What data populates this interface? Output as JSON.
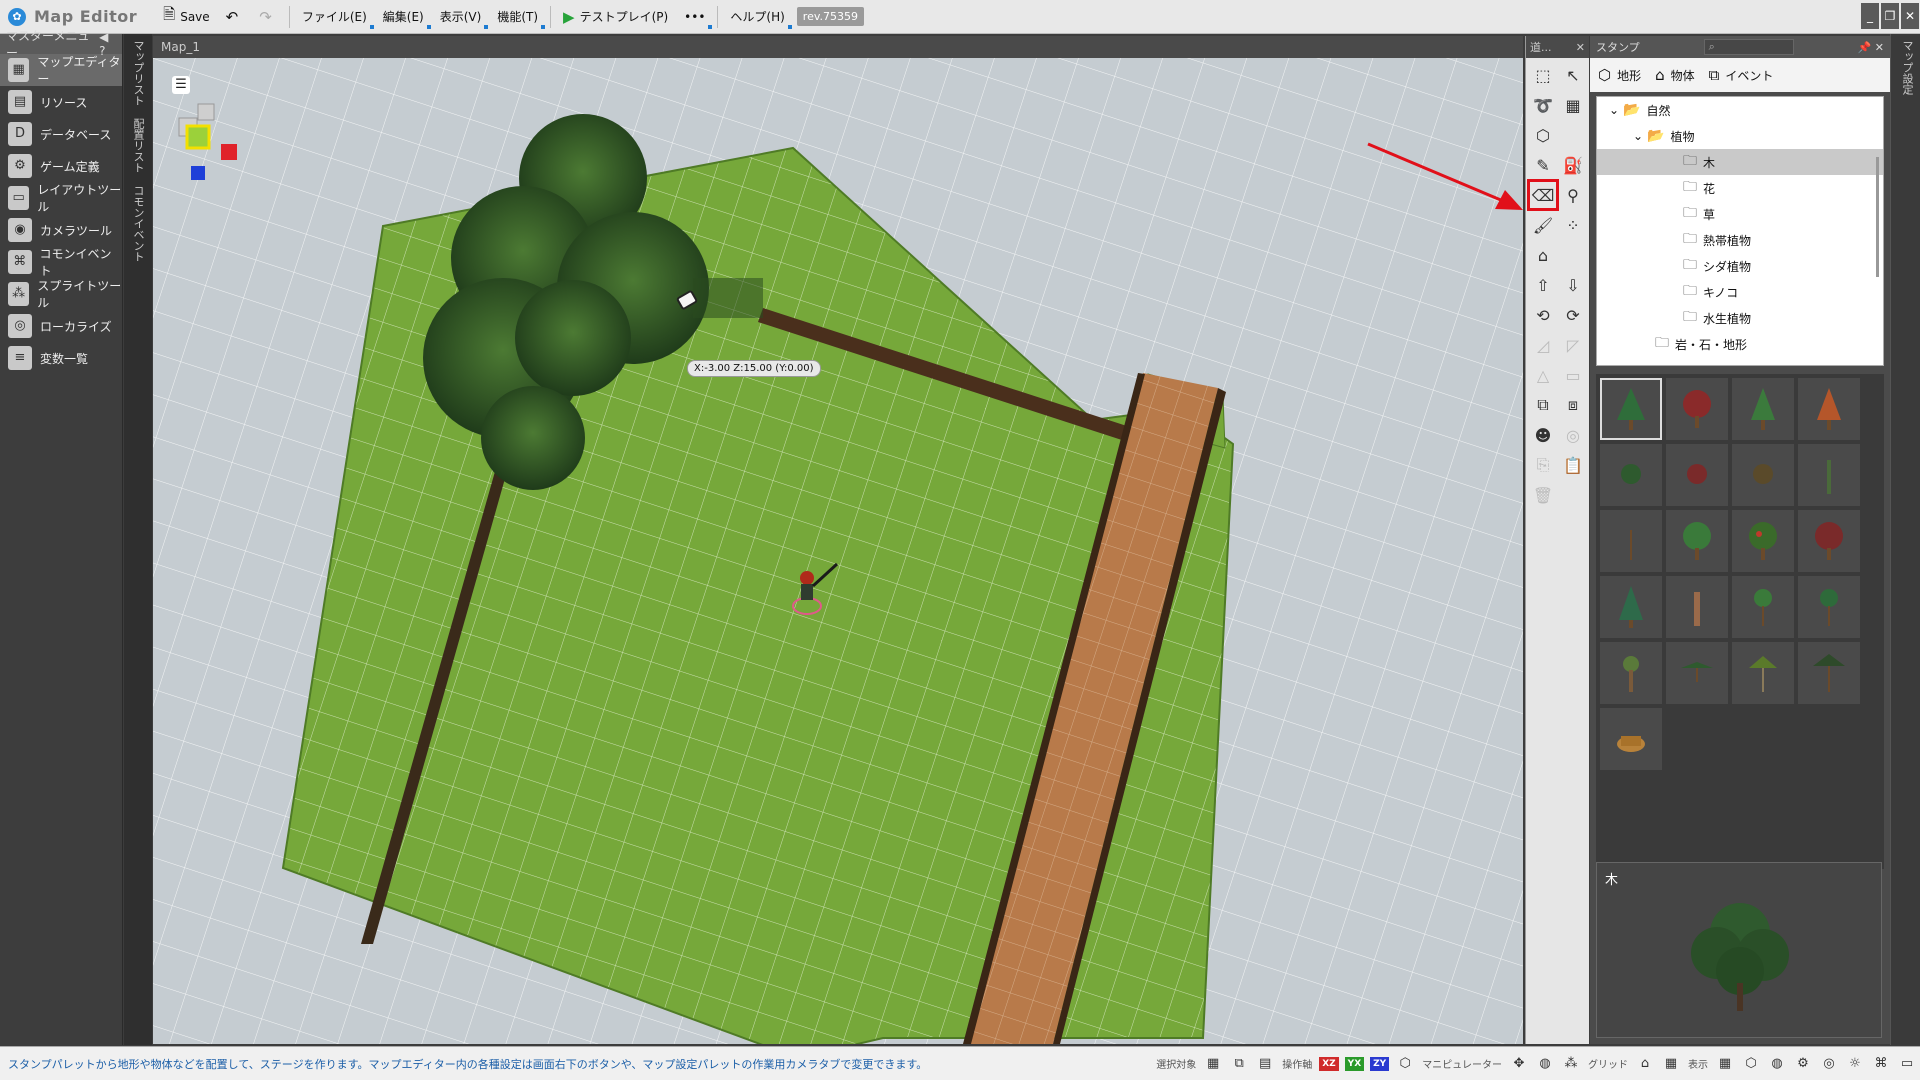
{
  "app": {
    "title": "Map Editor",
    "rev": "rev.75359"
  },
  "toolbar": {
    "save": "Save",
    "file": "ファイル(E)",
    "edit": "編集(E)",
    "view": "表示(V)",
    "func": "機能(T)",
    "testplay": "テストプレイ(P)",
    "more": "•••",
    "help": "ヘルプ(H)"
  },
  "master_menu": {
    "title": "マスターメニュー",
    "items": [
      {
        "label": "マップエディター",
        "icon": "map-icon"
      },
      {
        "label": "リソース",
        "icon": "resource-icon"
      },
      {
        "label": "データベース",
        "icon": "database-icon"
      },
      {
        "label": "ゲーム定義",
        "icon": "game-icon"
      },
      {
        "label": "レイアウトツール",
        "icon": "layout-icon"
      },
      {
        "label": "カメラツール",
        "icon": "camera-icon"
      },
      {
        "label": "コモンイベント",
        "icon": "event-icon"
      },
      {
        "label": "スプライトツール",
        "icon": "sprite-icon"
      },
      {
        "label": "ローカライズ",
        "icon": "globe-icon"
      },
      {
        "label": "変数一覧",
        "icon": "variable-icon"
      }
    ]
  },
  "vertical_tabs": {
    "map_list": "マップリスト",
    "placement_list": "配置リスト",
    "common_event": "コモンイベント"
  },
  "viewport": {
    "title": "Map_1",
    "coord": "X:-3.00 Z:15.00 (Y:0.00)"
  },
  "tools_panel": {
    "title": "道..."
  },
  "stamp_panel": {
    "title": "スタンプ",
    "tabs": [
      "地形",
      "物体",
      "イベント"
    ],
    "tree": [
      {
        "label": "自然",
        "depth": 0
      },
      {
        "label": "植物",
        "depth": 1
      },
      {
        "label": "木",
        "depth": 2,
        "selected": true
      },
      {
        "label": "花",
        "depth": 2
      },
      {
        "label": "草",
        "depth": 2
      },
      {
        "label": "熱帯植物",
        "depth": 2
      },
      {
        "label": "シダ植物",
        "depth": 2
      },
      {
        "label": "キノコ",
        "depth": 2
      },
      {
        "label": "水生植物",
        "depth": 2
      },
      {
        "label": "岩・石・地形",
        "depth": 1
      }
    ],
    "preview_label": "木"
  },
  "right_strip": {
    "label": "マップ設定"
  },
  "statusbar": {
    "message": "スタンプパレットから地形や物体などを配置して、ステージを作ります。マップエディター内の各種設定は画面右下のボタンや、マップ設定パレットの作業用カメラタブで変更できます。",
    "selection_target": "選択対象",
    "operation_axis": "操作軸",
    "manipulator": "マニピュレーター",
    "grid": "グリッド",
    "display": "表示"
  }
}
